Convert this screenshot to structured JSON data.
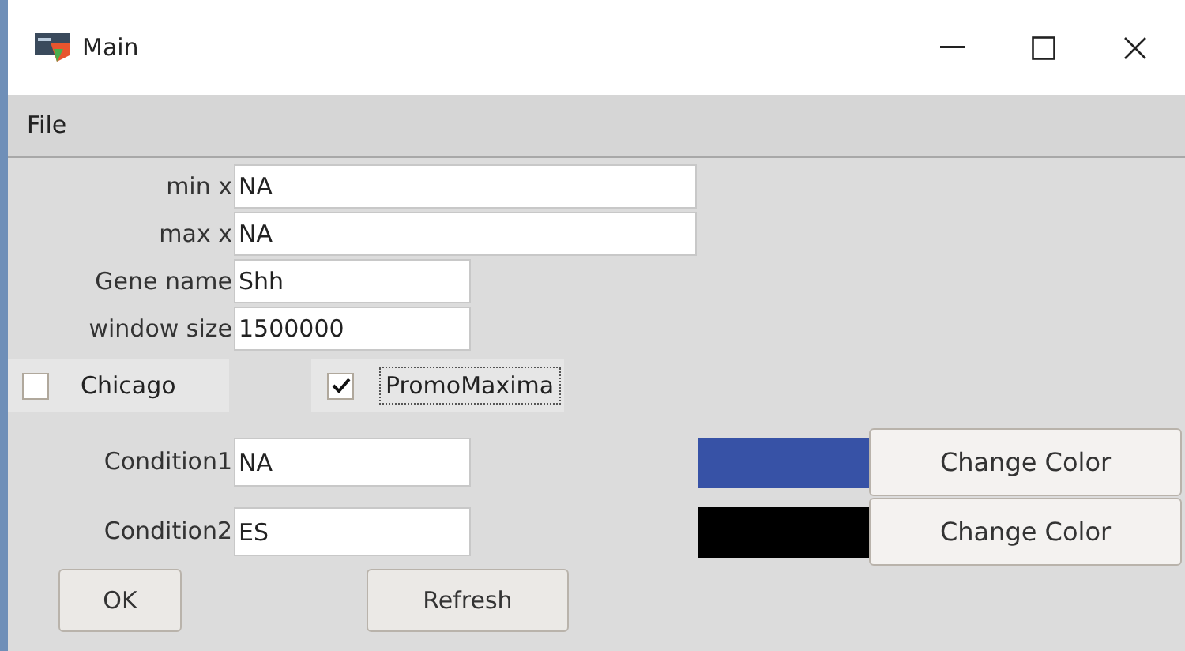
{
  "window": {
    "title": "Main"
  },
  "menu": [
    "File"
  ],
  "fields": [
    {
      "label": "min x",
      "value": "NA",
      "wide": true
    },
    {
      "label": "max x",
      "value": "NA",
      "wide": true
    },
    {
      "label": "Gene name",
      "value": "Shh",
      "wide": false
    },
    {
      "label": "window size",
      "value": "1500000",
      "wide": false
    }
  ],
  "checkboxes": [
    {
      "label": "Chicago",
      "checked": false,
      "focused": false
    },
    {
      "label": "PromoMaxima",
      "checked": true,
      "focused": true
    }
  ],
  "conditions": [
    {
      "label": "Condition1",
      "value": "NA",
      "color": "#3752a6",
      "button": "Change Color"
    },
    {
      "label": "Condition2",
      "value": "ES",
      "color": "#000000",
      "button": "Change Color"
    }
  ],
  "buttons": [
    "OK",
    "Refresh"
  ]
}
